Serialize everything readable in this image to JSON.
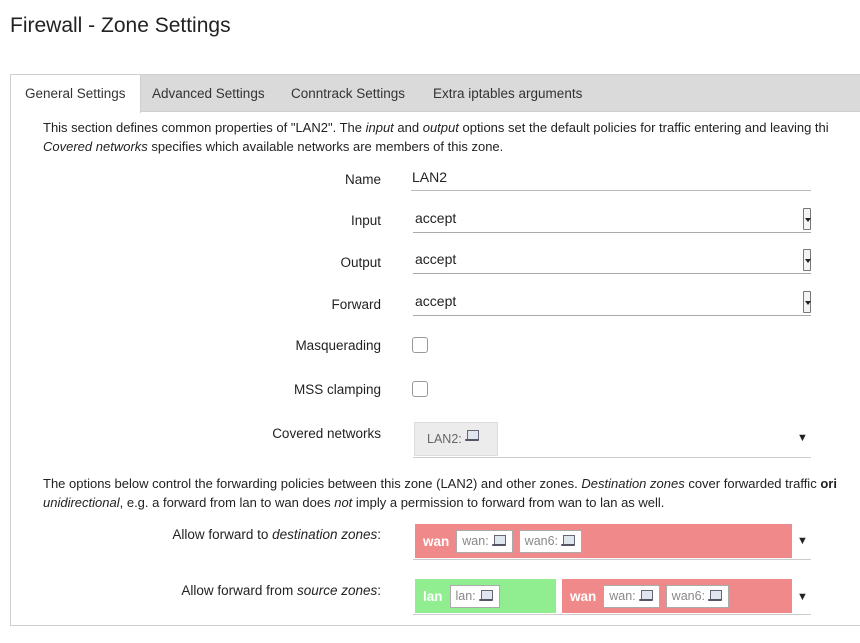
{
  "page": {
    "title": "Firewall - Zone Settings"
  },
  "tabs": [
    {
      "label": "General Settings",
      "active": true
    },
    {
      "label": "Advanced Settings",
      "active": false
    },
    {
      "label": "Conntrack Settings",
      "active": false
    },
    {
      "label": "Extra iptables arguments",
      "active": false
    }
  ],
  "general": {
    "intro": {
      "p1": "This section defines common properties of \"LAN2\". The ",
      "p1_em1": "input",
      "p1_mid": " and ",
      "p1_em2": "output",
      "p1_end": " options set the default policies for traffic entering and leaving thi",
      "p2_em": "Covered networks",
      "p2_end": " specifies which available networks are members of this zone."
    },
    "fields": {
      "name": {
        "label": "Name",
        "value": "LAN2"
      },
      "input": {
        "label": "Input",
        "value": "accept"
      },
      "output": {
        "label": "Output",
        "value": "accept"
      },
      "forward": {
        "label": "Forward",
        "value": "accept"
      },
      "masquerading": {
        "label": "Masquerading",
        "checked": false
      },
      "mss_clamping": {
        "label": "MSS clamping",
        "checked": false
      },
      "covered_networks": {
        "label": "Covered networks",
        "chip": "LAN2:"
      }
    }
  },
  "forwarding": {
    "intro": {
      "p1": "The options below control the forwarding policies between this zone (LAN2) and other zones. ",
      "p1_em": "Destination zones",
      "p1_end": " cover forwarded traffic ",
      "p1_bold": "ori",
      "p2_em": "unidirectional",
      "p2_mid": ", e.g. a forward from lan to wan does ",
      "p2_em2": "not",
      "p2_end": " imply a permission to forward from wan to lan as well."
    },
    "dest": {
      "label_pre": "Allow forward to ",
      "label_em": "destination zones",
      "label_post": ":",
      "zones": [
        {
          "name": "wan",
          "color": "#f08a8a",
          "chips": [
            "wan:",
            "wan6:"
          ]
        }
      ]
    },
    "source": {
      "label_pre": "Allow forward from ",
      "label_em": "source zones",
      "label_post": ":",
      "zones": [
        {
          "name": "lan",
          "color": "#90ee90",
          "chips": [
            "lan:"
          ]
        },
        {
          "name": "wan",
          "color": "#f08a8a",
          "chips": [
            "wan:",
            "wan6:"
          ]
        }
      ]
    }
  },
  "icons": {
    "dropdown": "▼",
    "network": "network-icon"
  }
}
